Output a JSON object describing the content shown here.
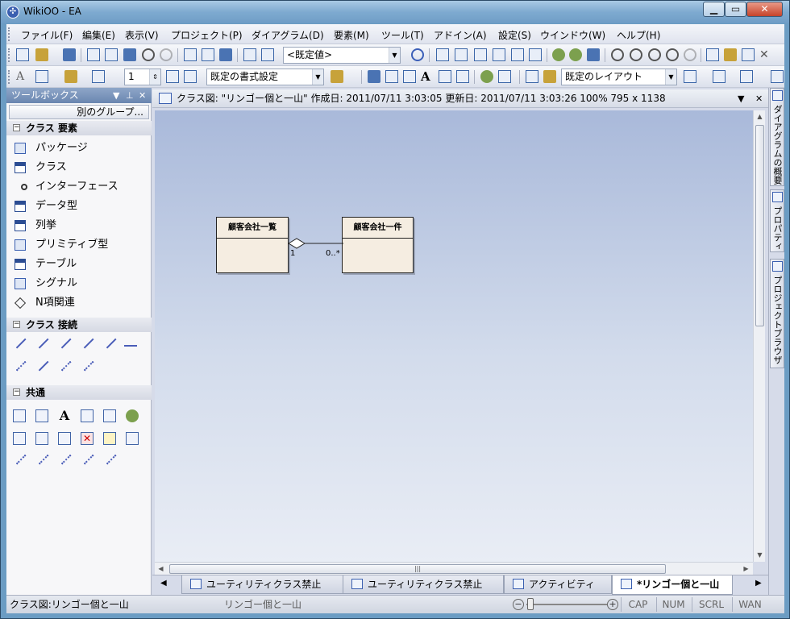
{
  "window": {
    "title": "WikiOO - EA"
  },
  "menu": [
    {
      "label": "ファイル(F)"
    },
    {
      "label": "編集(E)"
    },
    {
      "label": "表示(V)"
    },
    {
      "label": "プロジェクト(P)"
    },
    {
      "label": "ダイアグラム(D)"
    },
    {
      "label": "要素(M)"
    },
    {
      "label": "ツール(T)"
    },
    {
      "label": "アドイン(A)"
    },
    {
      "label": "設定(S)"
    },
    {
      "label": "ウインドウ(W)"
    },
    {
      "label": "ヘルプ(H)"
    }
  ],
  "toolbar1": {
    "style_combo": "<既定値>"
  },
  "toolbar2": {
    "line_width": "1",
    "format_combo": "既定の書式設定",
    "layout_combo": "既定のレイアウト"
  },
  "toolbox": {
    "title": "ツールボックス",
    "other_groups_button": "別のグループ...",
    "sections": [
      {
        "title": "クラス 要素",
        "items": [
          {
            "label": "パッケージ",
            "icon": "package-icon"
          },
          {
            "label": "クラス",
            "icon": "class-icon"
          },
          {
            "label": "インターフェース",
            "icon": "interface-icon"
          },
          {
            "label": "データ型",
            "icon": "datatype-icon"
          },
          {
            "label": "列挙",
            "icon": "enumeration-icon"
          },
          {
            "label": "プリミティブ型",
            "icon": "primitive-icon"
          },
          {
            "label": "テーブル",
            "icon": "table-icon"
          },
          {
            "label": "シグナル",
            "icon": "signal-icon"
          },
          {
            "label": "N項関連",
            "icon": "nary-association-icon"
          }
        ]
      },
      {
        "title": "クラス 接続"
      },
      {
        "title": "共通"
      }
    ]
  },
  "diagram_header": {
    "text": "クラス図: \"リンゴー個と一山\"   作成日: 2011/07/11 3:03:05  更新日: 2011/07/11 3:03:26   100%   795 x 1138"
  },
  "diagram": {
    "classes": [
      {
        "name": "顧客会社一覧"
      },
      {
        "name": "顧客会社一件"
      }
    ],
    "association": {
      "source_multiplicity": "1",
      "target_multiplicity": "0..*"
    }
  },
  "tabs": [
    {
      "label": "ユーティリティクラス禁止"
    },
    {
      "label": "ユーティリティクラス禁止"
    },
    {
      "label": "アクティビティ"
    },
    {
      "label": "*リンゴー個と一山",
      "active": true
    }
  ],
  "dock_tabs": [
    {
      "label": "ダイアグラムの概要"
    },
    {
      "label": "プロパティ"
    },
    {
      "label": "プロジェクトブラウザ"
    }
  ],
  "status": {
    "left": "クラス図:リンゴー個と一山",
    "center": "リンゴー個と一山",
    "indicators": [
      "CAP",
      "NUM",
      "SCRL",
      "WAN"
    ]
  }
}
